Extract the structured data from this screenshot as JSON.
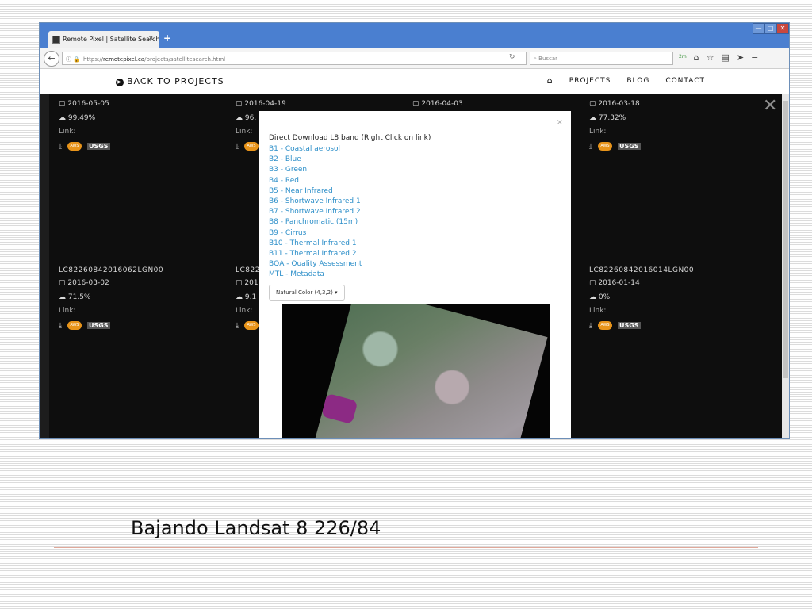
{
  "browser": {
    "tab_title": "Remote Pixel | Satellite Search",
    "tab_close": "✕",
    "new_tab": "+",
    "url_scheme": "https://",
    "url_host": "remotepixel.ca",
    "url_path": "/projects/satellitesearch.html",
    "search_placeholder": "Buscar",
    "toolbar_badge": "2m"
  },
  "site_header": {
    "back_link": "BACK TO PROJECTS",
    "nav": [
      "PROJECTS",
      "BLOG",
      "CONTACT"
    ]
  },
  "results": {
    "row1": [
      {
        "date": "2016-05-05",
        "cloud": "99.49%",
        "link": "Link:"
      },
      {
        "date": "2016-04-19",
        "cloud": "96.",
        "link": "Link:"
      },
      {
        "date": "2016-04-03"
      },
      {
        "date": "2016-03-18",
        "cloud": "77.32%",
        "link": "Link:"
      }
    ],
    "row2": [
      {
        "scene_id": "LC82260842016062LGN00",
        "date": "2016-03-02",
        "cloud": "71.5%",
        "link": "Link:"
      },
      {
        "scene_id": "LC822",
        "date": "201",
        "cloud": "9.1",
        "link": "Link:"
      },
      {
        "scene_id": "LC82260842016014LGN00",
        "date": "2016-01-14",
        "cloud": "0%",
        "link": "Link:"
      }
    ],
    "badges": {
      "aws": "AWS",
      "usgs": "USGS"
    }
  },
  "modal": {
    "close": "×",
    "heading": "Direct Download L8 band (Right Click on link)",
    "bands": [
      "B1 - Coastal aerosol",
      "B2 - Blue",
      "B3 - Green",
      "B4 - Red",
      "B5 - Near Infrared",
      "B6 - Shortwave Infrared 1",
      "B7 - Shortwave Infrared 2",
      "B8 - Panchromatic (15m)",
      "B9 - Cirrus",
      "B10 - Thermal Infrared 1",
      "B11 - Thermal Infrared 2",
      "BQA - Quality Assessment",
      "MTL - Metadata"
    ],
    "composite": "Natural Color (4,3,2) ▾"
  },
  "slide": {
    "caption": "Bajando Landsat 8 226/84"
  }
}
